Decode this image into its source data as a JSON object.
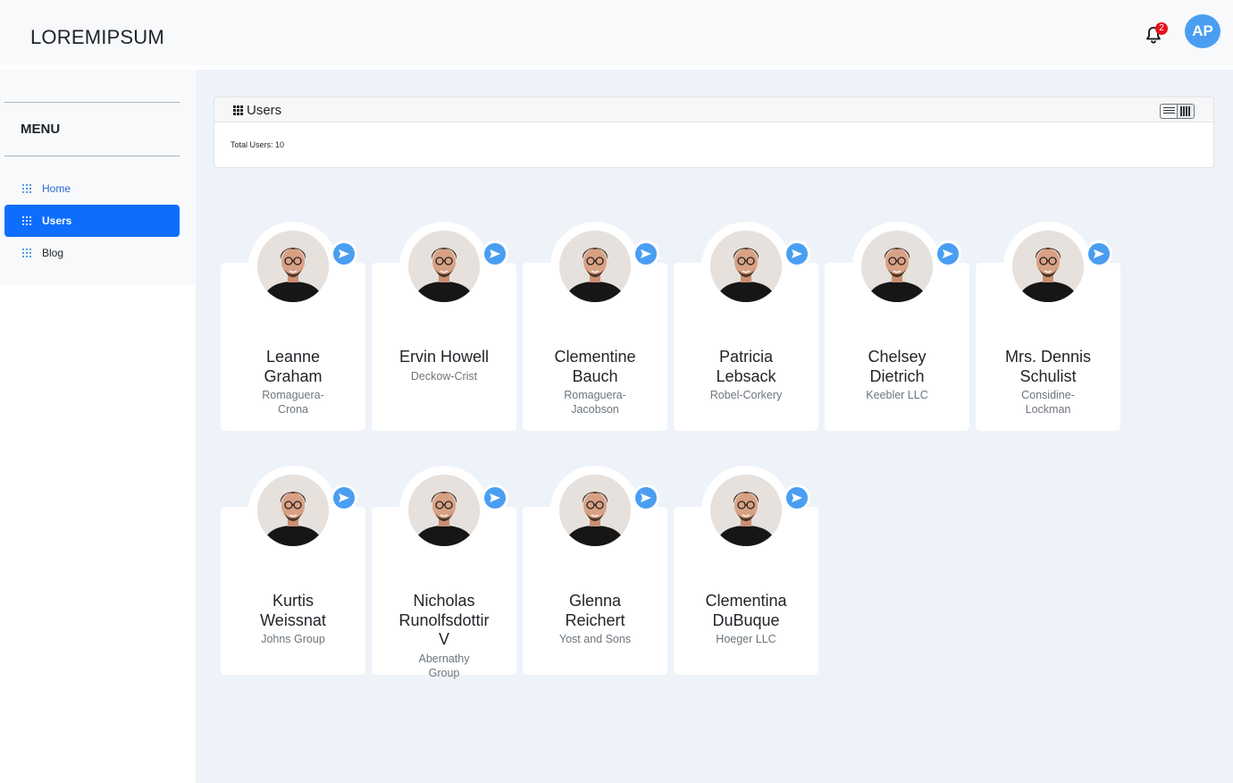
{
  "header": {
    "brand": "LOREMIPSUM",
    "notification_count": "2",
    "avatar_initials": "AP"
  },
  "sidebar": {
    "title": "MENU",
    "items": [
      {
        "label": "Home"
      },
      {
        "label": "Users"
      },
      {
        "label": "Blog"
      }
    ]
  },
  "panel": {
    "title": "Users",
    "total": "Total Users: 10"
  },
  "users": [
    {
      "name": "Leanne Graham",
      "company": "Romaguera-Crona"
    },
    {
      "name": "Ervin Howell",
      "company": "Deckow-Crist"
    },
    {
      "name": "Clementine Bauch",
      "company": "Romaguera-Jacobson"
    },
    {
      "name": "Patricia Lebsack",
      "company": "Robel-Corkery"
    },
    {
      "name": "Chelsey Dietrich",
      "company": "Keebler LLC"
    },
    {
      "name": "Mrs. Dennis Schulist",
      "company": "Considine-Lockman"
    },
    {
      "name": "Kurtis Weissnat",
      "company": "Johns Group"
    },
    {
      "name": "Nicholas Runolfsdottir V",
      "company": "Abernathy Group"
    },
    {
      "name": "Glenna Reichert",
      "company": "Yost and Sons"
    },
    {
      "name": "Clementina DuBuque",
      "company": "Hoeger LLC"
    }
  ],
  "colors": {
    "accent": "#0d6efd",
    "avatar": "#4a9ef2",
    "badge": "#e8101d",
    "background": "#eef3fa"
  },
  "icons": {
    "bell": "bell-icon",
    "grid": "grid-icon",
    "send": "send-icon",
    "list_view": "list-view-icon",
    "card_view": "card-view-icon"
  }
}
